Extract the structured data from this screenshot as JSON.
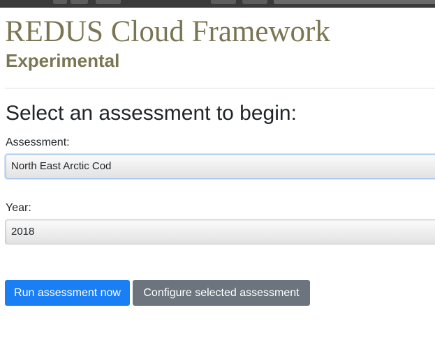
{
  "header": {
    "title": "REDUS Cloud Framework",
    "subtitle": "Experimental"
  },
  "main": {
    "heading": "Select an assessment to begin:",
    "assessment": {
      "label": "Assessment:",
      "selected": "North East Arctic Cod"
    },
    "year": {
      "label": "Year:",
      "selected": "2018"
    }
  },
  "actions": {
    "run_label": "Run assessment now",
    "configure_label": "Configure selected assessment"
  },
  "colors": {
    "title": "#7a7552",
    "primary_button": "#1a7ef5",
    "secondary_button": "#6c757d",
    "focus_border": "#9ec5f5"
  }
}
